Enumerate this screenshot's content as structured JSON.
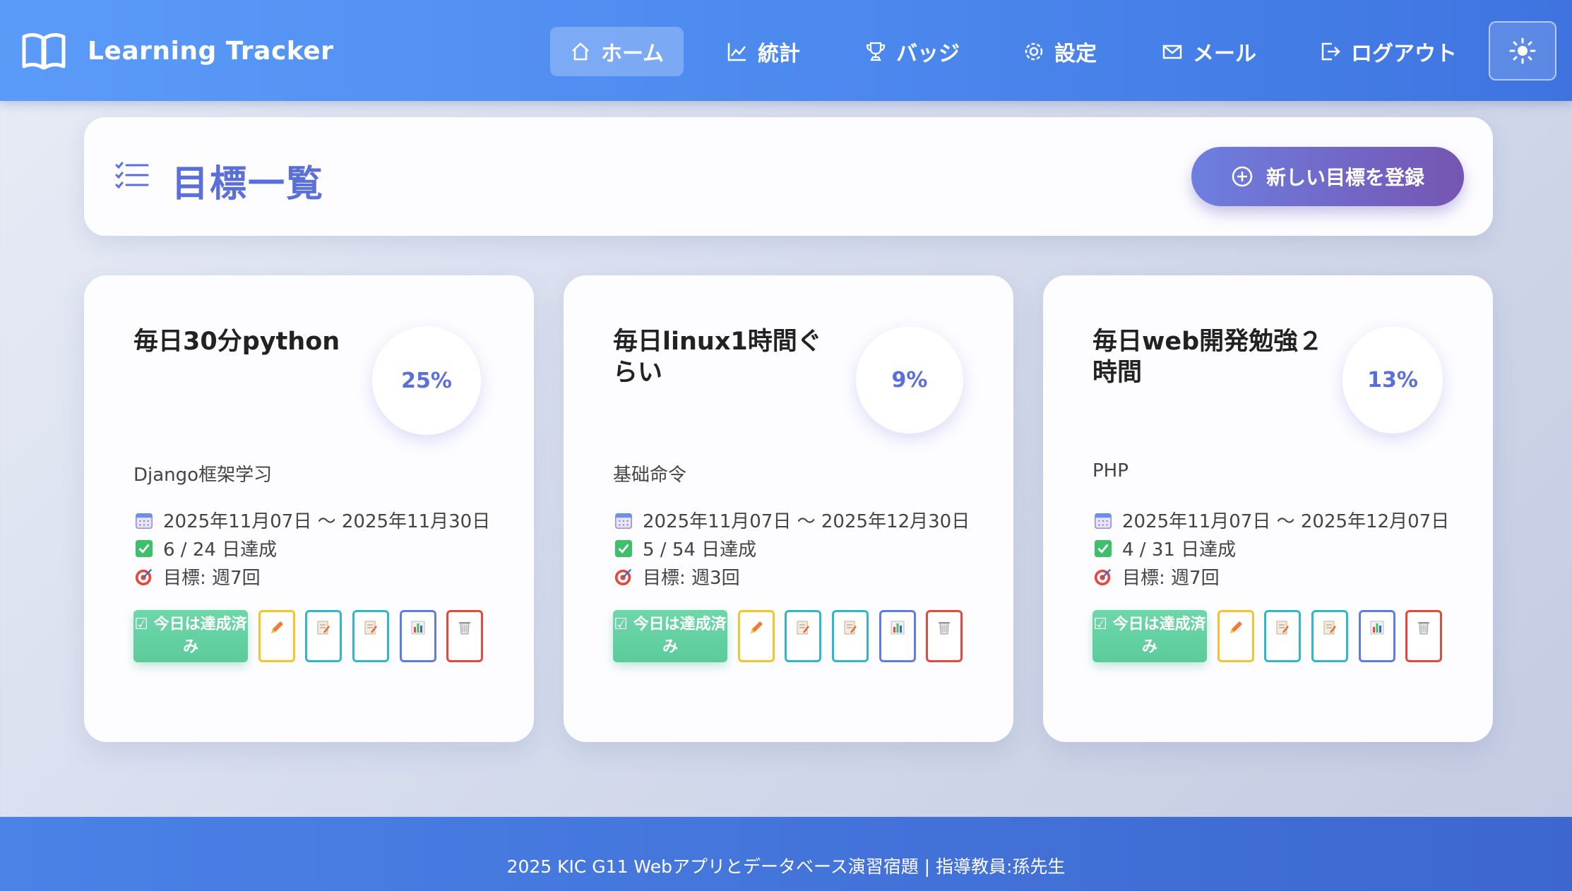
{
  "nav": {
    "brand": "Learning Tracker",
    "items": [
      {
        "label": "ホーム",
        "icon": "home-icon",
        "active": true
      },
      {
        "label": "統計",
        "icon": "chart-line-icon"
      },
      {
        "label": "バッジ",
        "icon": "trophy-icon"
      },
      {
        "label": "設定",
        "icon": "gear-icon"
      },
      {
        "label": "メール",
        "icon": "envelope-icon"
      },
      {
        "label": "ログアウト",
        "icon": "logout-icon"
      }
    ],
    "theme_icon": "sun-icon"
  },
  "header": {
    "title": "目標一覧",
    "add_button": "新しい目標を登録"
  },
  "cards": [
    {
      "title": "毎日30分python",
      "percent": "25%",
      "description": "Django框架学习",
      "period": "2025年11月07日 〜 2025年11月30日",
      "progress": "6 / 24 日達成",
      "target": "目標: 週7回",
      "done_label": "☑ 今日は達成済み"
    },
    {
      "title": "毎日linux1時間ぐらい",
      "percent": "9%",
      "description": "基础命令",
      "period": "2025年11月07日 〜 2025年12月30日",
      "progress": "5 / 54 日達成",
      "target": "目標: 週3回",
      "done_label": "☑ 今日は達成済み"
    },
    {
      "title": "毎日web開発勉強２時間",
      "percent": "13%",
      "description": "PHP",
      "period": "2025年11月07日 〜 2025年12月07日",
      "progress": "4 / 31 日達成",
      "target": "目標: 週7回",
      "done_label": "☑ 今日は達成済み"
    }
  ],
  "footer": {
    "text": "2025 KIC G11 Webアプリとデータベース演習宿題 | 指導教員:孫先生"
  },
  "colors": {
    "nav": "#4a86ec",
    "accent": "#5b6fd8",
    "success": "#5ccb9b",
    "danger": "#e5483d"
  }
}
